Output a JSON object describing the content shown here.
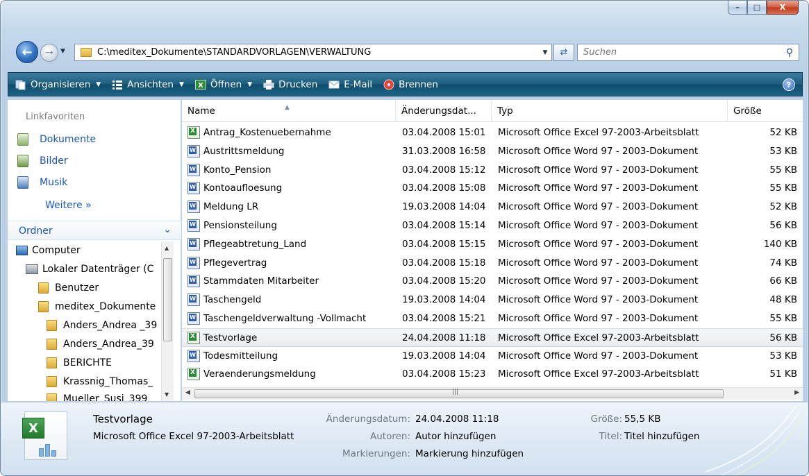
{
  "window": {
    "caption_buttons": {
      "minimize": "–",
      "maximize": "□",
      "close": "X"
    }
  },
  "address": {
    "path": "C:\\meditex_Dokumente\\STANDARDVORLAGEN\\VERWALTUNG",
    "search_placeholder": "Suchen"
  },
  "toolbar": {
    "organisieren": "Organisieren",
    "ansichten": "Ansichten",
    "oeffnen": "Öffnen",
    "drucken": "Drucken",
    "email": "E-Mail",
    "brennen": "Brennen",
    "help": "?"
  },
  "nav_pane": {
    "favorites_header": "Linkfavoriten",
    "favorites": [
      "Dokumente",
      "Bilder",
      "Musik"
    ],
    "more": "Weitere »",
    "folders_header": "Ordner",
    "tree": [
      "Computer",
      "Lokaler Datenträger (C",
      "Benutzer",
      "meditex_Dokumente",
      "Anders_Andrea _39",
      "Anders_Andrea_39",
      "BERICHTE",
      "Krassnig_Thomas_",
      "Mueller_Susi_399"
    ]
  },
  "columns": {
    "name": "Name",
    "date": "Änderungsdat...",
    "type": "Typ",
    "size": "Größe"
  },
  "files": [
    {
      "name": "Antrag_Kostenuebernahme",
      "date": "03.04.2008 15:01",
      "type": "Microsoft Office Excel 97-2003-Arbeitsblatt",
      "size": "52 KB",
      "kind": "excel"
    },
    {
      "name": "Austrittsmeldung",
      "date": "31.03.2008 16:58",
      "type": "Microsoft Office Word 97 - 2003-Dokument",
      "size": "53 KB",
      "kind": "word"
    },
    {
      "name": "Konto_Pension",
      "date": "03.04.2008 15:12",
      "type": "Microsoft Office Word 97 - 2003-Dokument",
      "size": "55 KB",
      "kind": "word"
    },
    {
      "name": "Kontoaufloesung",
      "date": "03.04.2008 15:08",
      "type": "Microsoft Office Word 97 - 2003-Dokument",
      "size": "55 KB",
      "kind": "word"
    },
    {
      "name": "Meldung LR",
      "date": "19.03.2008 14:04",
      "type": "Microsoft Office Word 97 - 2003-Dokument",
      "size": "52 KB",
      "kind": "word"
    },
    {
      "name": "Pensionsteilung",
      "date": "03.04.2008 15:14",
      "type": "Microsoft Office Word 97 - 2003-Dokument",
      "size": "56 KB",
      "kind": "word"
    },
    {
      "name": "Pflegeabtretung_Land",
      "date": "03.04.2008 15:15",
      "type": "Microsoft Office Word 97 - 2003-Dokument",
      "size": "140 KB",
      "kind": "word"
    },
    {
      "name": "Pflegevertrag",
      "date": "03.04.2008 15:18",
      "type": "Microsoft Office Word 97 - 2003-Dokument",
      "size": "74 KB",
      "kind": "word"
    },
    {
      "name": "Stammdaten Mitarbeiter",
      "date": "03.04.2008 15:20",
      "type": "Microsoft Office Word 97 - 2003-Dokument",
      "size": "66 KB",
      "kind": "word"
    },
    {
      "name": "Taschengeld",
      "date": "19.03.2008 14:04",
      "type": "Microsoft Office Word 97 - 2003-Dokument",
      "size": "48 KB",
      "kind": "word"
    },
    {
      "name": "Taschengeldverwaltung -Vollmacht",
      "date": "03.04.2008 15:21",
      "type": "Microsoft Office Word 97 - 2003-Dokument",
      "size": "55 KB",
      "kind": "word"
    },
    {
      "name": "Testvorlage",
      "date": "24.04.2008 11:18",
      "type": "Microsoft Office Excel 97-2003-Arbeitsblatt",
      "size": "56 KB",
      "kind": "excel",
      "selected": true
    },
    {
      "name": "Todesmitteilung",
      "date": "19.03.2008 14:04",
      "type": "Microsoft Office Word 97 - 2003-Dokument",
      "size": "53 KB",
      "kind": "word"
    },
    {
      "name": "Veraenderungsmeldung",
      "date": "03.04.2008 15:23",
      "type": "Microsoft Office Excel 97-2003-Arbeitsblatt",
      "size": "51 KB",
      "kind": "excel"
    }
  ],
  "details": {
    "title": "Testvorlage",
    "type": "Microsoft Office Excel 97-2003-Arbeitsblatt",
    "date_label": "Änderungsdatum:",
    "date_value": "24.04.2008 11:18",
    "authors_label": "Autoren:",
    "authors_value": "Autor hinzufügen",
    "tags_label": "Markierungen:",
    "tags_value": "Markierung hinzufügen",
    "size_label": "Größe:",
    "size_value": "55,5 KB",
    "title_label": "Titel:",
    "title_value": "Titel hinzufügen"
  },
  "colors": {
    "toolbar": "#1e5f80",
    "link": "#1b58b5",
    "excel": "#2d8a34",
    "word": "#2f5dae"
  }
}
